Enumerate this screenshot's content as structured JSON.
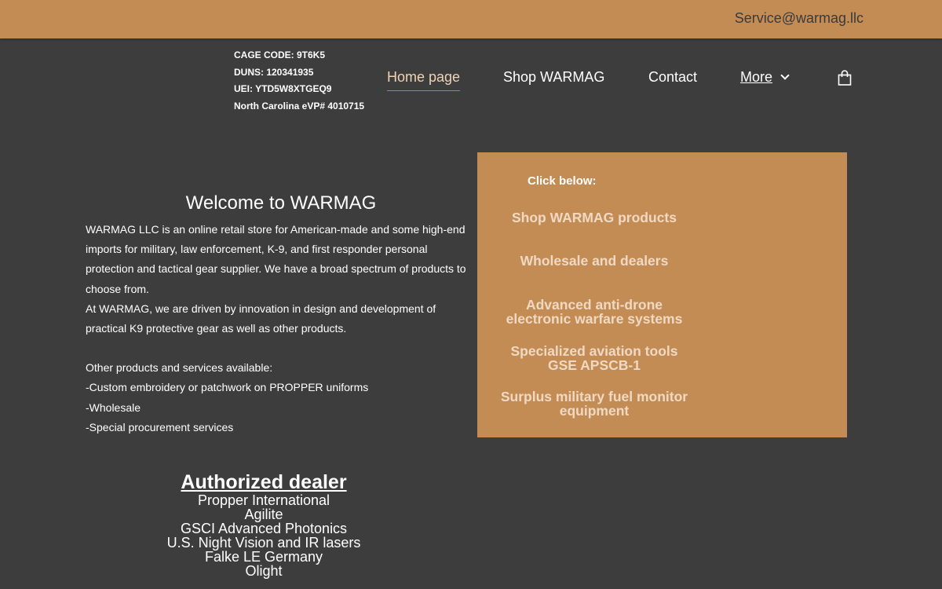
{
  "topbar": {
    "email": "Service@warmag.llc"
  },
  "company_info": {
    "cage_code": "CAGE CODE: 9T6K5",
    "duns": "DUNS: 120341935",
    "uei": "UEI: YTD5W8XTGEQ9",
    "evp": "North Carolina eVP# 4010715"
  },
  "nav": {
    "home": "Home page",
    "shop": "Shop WARMAG",
    "contact": "Contact",
    "more": "More",
    "cart_icon": "shopping-bag-icon"
  },
  "welcome": {
    "title": "Welcome to WARMAG",
    "para1": "WARMAG LLC is an online retail store for American-made and some high-end imports for military, law enforcement, K-9, and first responder personal protection and tactical gear supplier. We have a broad spectrum of products to choose from.",
    "para2": "At WARMAG, we are driven by innovation in design and development of practical K9 protective gear as well as other products.",
    "other_heading": "Other products and services available:",
    "service1": "-Custom embroidery or patchwork on PROPPER uniforms",
    "service2": "-Wholesale",
    "service3": "-Special procurement services"
  },
  "promo": {
    "click_below": "Click below:",
    "link1": "Shop WARMAG products",
    "link2": "Wholesale and dealers",
    "link3_line1": "Advanced anti-drone",
    "link3_line2": "electronic warfare systems",
    "link4_line1": "Specialized aviation tools",
    "link4_line2": "GSE APSCB-1",
    "link5_line1": "Surplus military fuel monitor",
    "link5_line2": "equipment"
  },
  "dealer": {
    "title": "Authorized dealer",
    "items": [
      "Propper International",
      "Agilite",
      "GSCI Advanced Photonics",
      "U.S. Night Vision and IR lasers",
      "Falke LE Germany",
      "Olight"
    ]
  },
  "colors": {
    "accent": "#c48c55",
    "background": "#3d3d3d",
    "active_underline": "#3aa6c9"
  }
}
